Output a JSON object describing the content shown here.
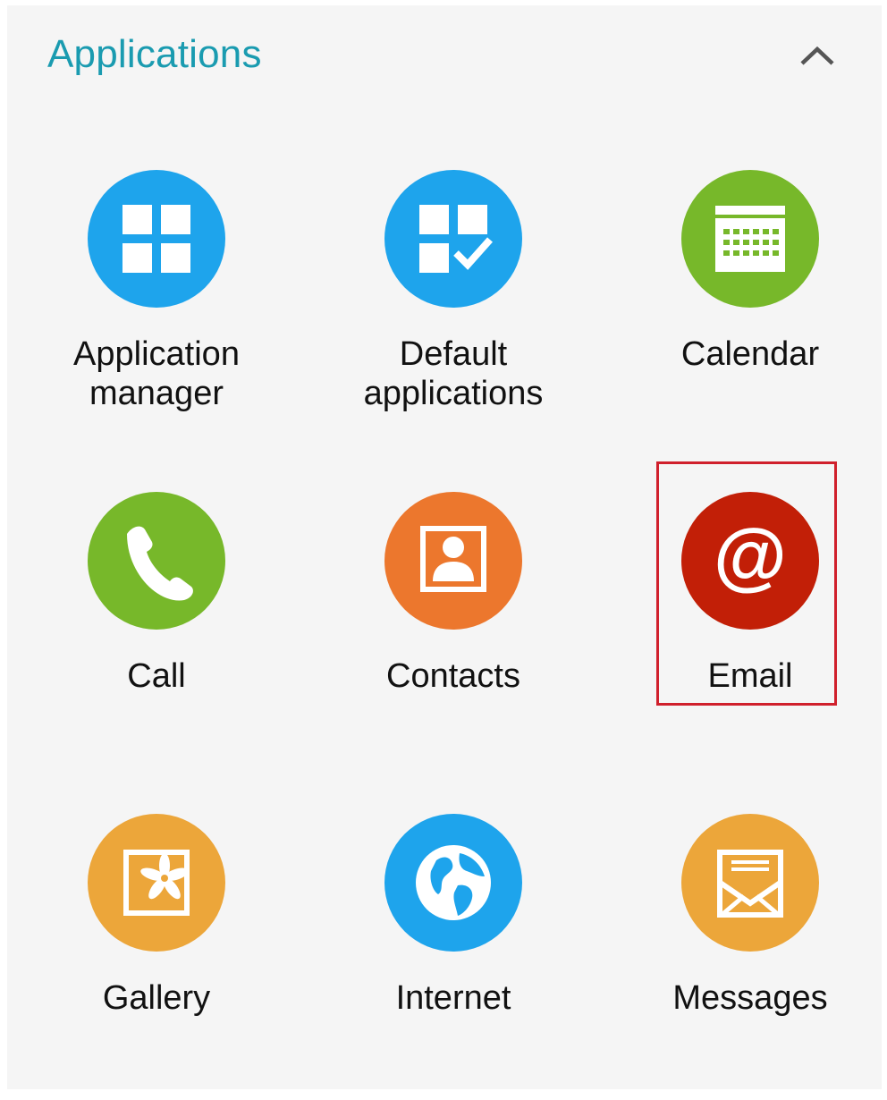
{
  "header": {
    "title": "Applications",
    "collapse_icon": "chevron-up-icon"
  },
  "apps": [
    {
      "label": "Application\nmanager",
      "icon": "app-grid-icon",
      "color": "#1ea4ec"
    },
    {
      "label": "Default\napplications",
      "icon": "grid-check-icon",
      "color": "#1ea4ec"
    },
    {
      "label": "Calendar",
      "icon": "calendar-icon",
      "color": "#77b82a"
    },
    {
      "label": "Call",
      "icon": "phone-icon",
      "color": "#77b82a"
    },
    {
      "label": "Contacts",
      "icon": "contact-card-icon",
      "color": "#ec772d"
    },
    {
      "label": "Email",
      "icon": "at-sign-icon",
      "color": "#c21f07",
      "highlighted": true
    },
    {
      "label": "Gallery",
      "icon": "gallery-flower-icon",
      "color": "#eca63a"
    },
    {
      "label": "Internet",
      "icon": "globe-icon",
      "color": "#1ea4ec"
    },
    {
      "label": "Messages",
      "icon": "envelope-icon",
      "color": "#eca63a"
    }
  ],
  "colors": {
    "accent": "#1a9bb0",
    "highlight_border": "#d0202c",
    "background": "#f5f5f5"
  }
}
